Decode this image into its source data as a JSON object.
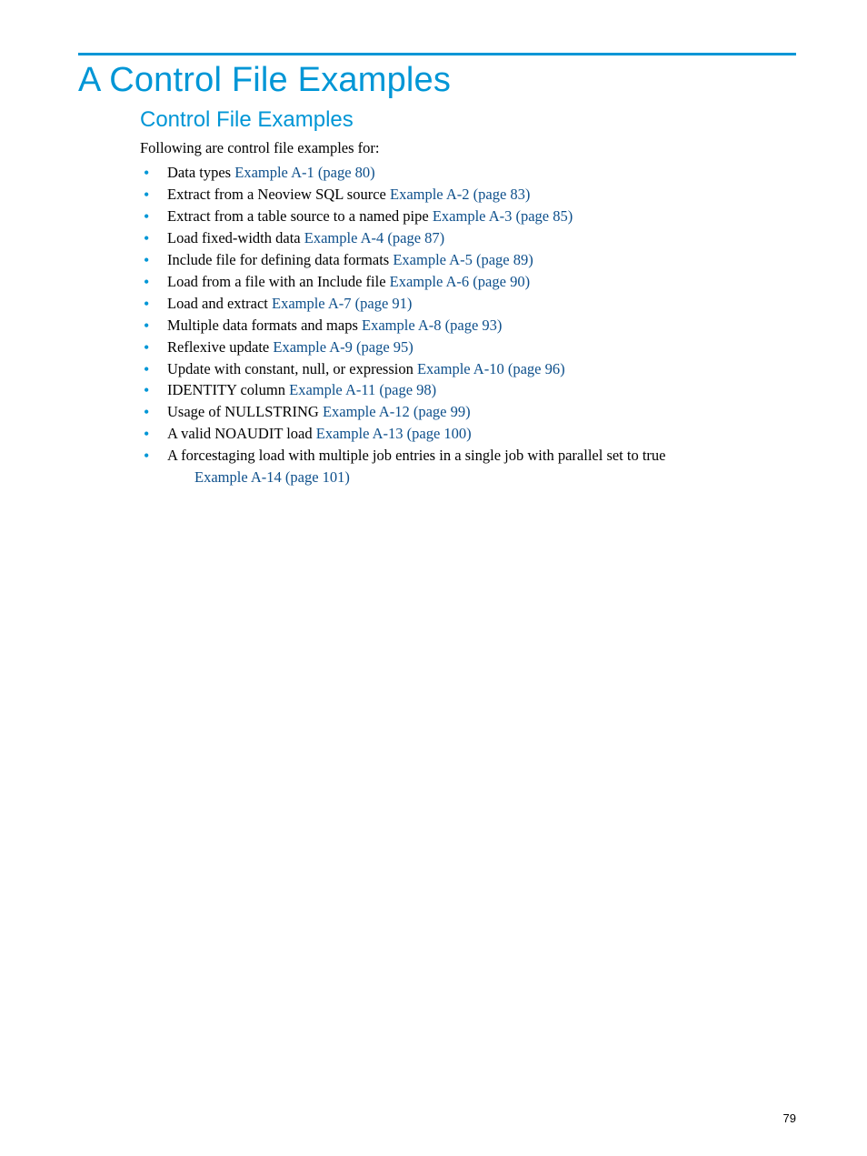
{
  "chapter": {
    "title": "A Control File Examples"
  },
  "section": {
    "title": "Control File Examples",
    "intro": "Following are control file examples for:"
  },
  "items": [
    {
      "text": "Data types ",
      "link": "Example A-1 (page 80)"
    },
    {
      "text": "Extract from a Neoview SQL source ",
      "link": "Example A-2 (page 83)"
    },
    {
      "text": "Extract from a table source to a named pipe ",
      "link": "Example A-3 (page 85)"
    },
    {
      "text": "Load fixed-width data ",
      "link": "Example A-4 (page 87)"
    },
    {
      "text": "Include file for defining data formats ",
      "link": "Example A-5 (page 89)"
    },
    {
      "text": "Load from a file with an Include file ",
      "link": "Example A-6 (page 90)"
    },
    {
      "text": "Load and extract ",
      "link": "Example A-7 (page 91)"
    },
    {
      "text": "Multiple data formats and maps ",
      "link": "Example A-8 (page 93)"
    },
    {
      "text": "Reflexive update ",
      "link": "Example A-9 (page 95)"
    },
    {
      "text": "Update with constant, null, or expression ",
      "link": "Example A-10 (page 96)"
    },
    {
      "text": "IDENTITY column ",
      "link": "Example A-11 (page 98)"
    },
    {
      "text": "Usage of NULLSTRING ",
      "link": "Example A-12 (page 99)"
    },
    {
      "text": "A valid NOAUDIT load ",
      "link": "Example A-13 (page 100)"
    },
    {
      "text": "A forcestaging load with multiple job entries in a single job with parallel set to true",
      "link": "Example A-14 (page 101)",
      "linkOnNewLine": true
    }
  ],
  "pageNumber": "79"
}
